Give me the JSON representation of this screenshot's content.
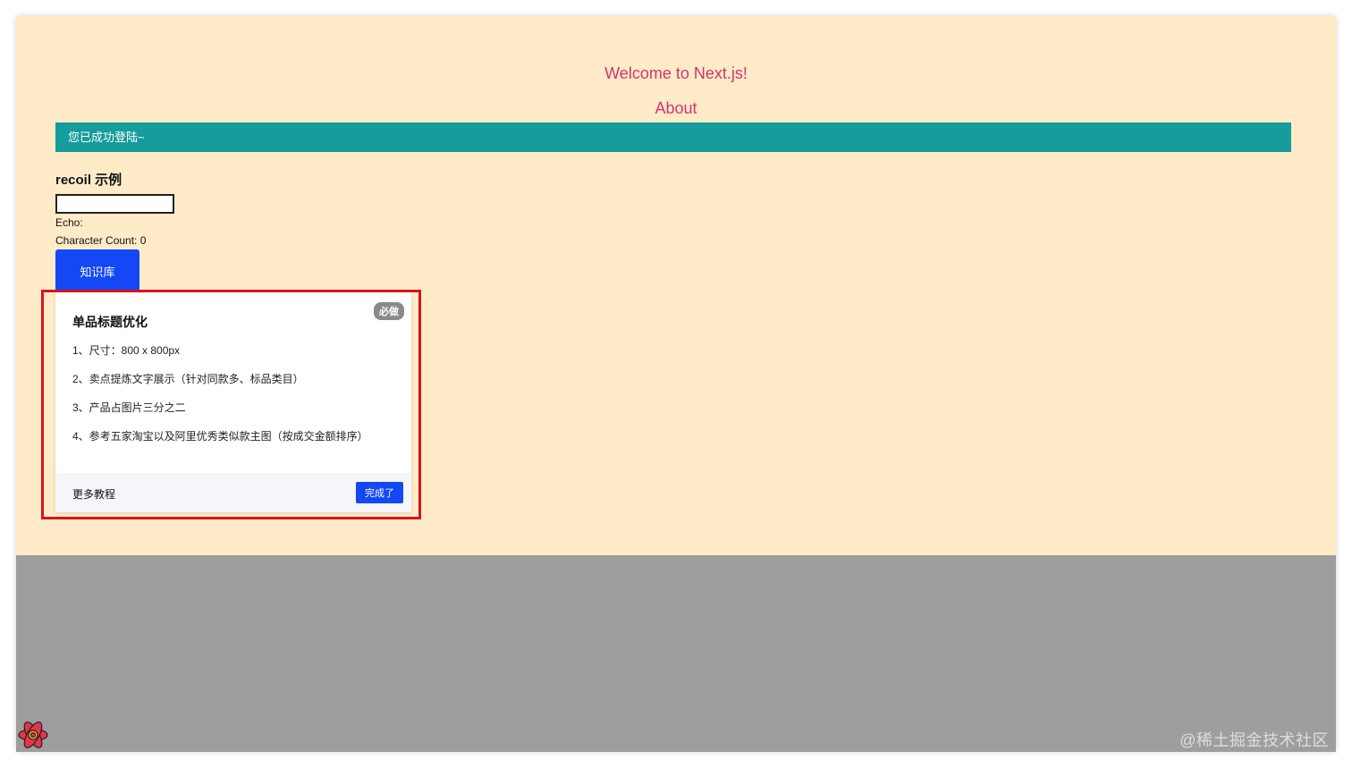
{
  "header": {
    "title": "Welcome to Next.js!",
    "about_link": "About"
  },
  "banner": {
    "message": "您已成功登陆~"
  },
  "recoil": {
    "title": "recoil 示例",
    "input_value": "",
    "echo_label": "Echo:",
    "count_label": "Character Count: 0"
  },
  "kb_button": {
    "label": "知识库"
  },
  "card": {
    "badge": "必做",
    "title": "单品标题优化",
    "items": [
      "1、尺寸：800 x 800px",
      "2、卖点提炼文字展示（针对同款多、标品类目）",
      "3、产品占图片三分之二",
      "4、参考五家淘宝以及阿里优秀类似款主图（按成交金额排序）"
    ],
    "more_link": "更多教程",
    "done_button": "完成了"
  },
  "colors": {
    "page_bg": "#ffebc8",
    "title_pink": "#d6336c",
    "banner_teal": "#169c9c",
    "primary_blue": "#1448f5",
    "highlight_red": "#d5141c",
    "overlay_gray": "#9e9e9e"
  },
  "icons": {
    "devtools": "react-atom-icon"
  },
  "watermark": "@稀土掘金技术社区"
}
